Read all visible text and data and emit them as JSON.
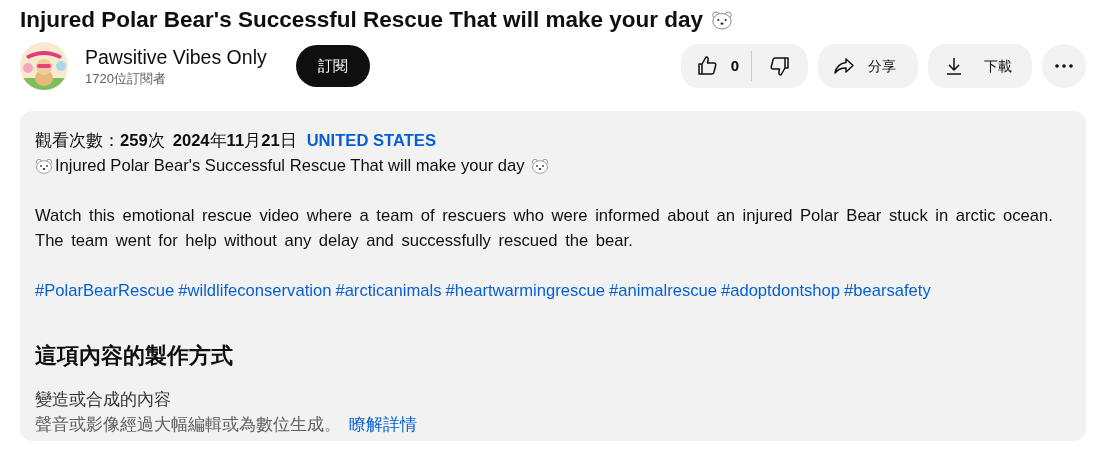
{
  "video": {
    "title": "Injured Polar Bear's Successful Rescue That will make your day",
    "title_emoji": true
  },
  "channel": {
    "name": "Pawsitive Vibes Only",
    "subscribers": "1720位訂閱者"
  },
  "subscribe_button": "訂閱",
  "actions": {
    "likes": "0",
    "share": "分享",
    "download": "下載"
  },
  "description": {
    "views": "觀看次數：**259**次",
    "date": "**2024**年**11**月**21**日",
    "location": "UNITED STATES",
    "headline": "Injured Polar Bear's Successful Rescue That will make your day",
    "paragraph": "Watch this emotional rescue video where a team of rescuers who were informed about an injured Polar Bear stuck in arctic ocean. The team went for help without any delay and successfully rescued the bear.",
    "hashtags": [
      "#PolarBearRescue",
      "#wildlifeconservation",
      "#arcticanimals",
      "#heartwarmingrescue",
      "#animalrescue",
      "#adoptdontshop",
      "#bearsafety"
    ]
  },
  "how_made": {
    "heading": "這項內容的製作方式",
    "label": "變造或合成的內容",
    "text": "聲音或影像經過大幅編輯或為數位生成。",
    "link": "瞭解詳情"
  }
}
